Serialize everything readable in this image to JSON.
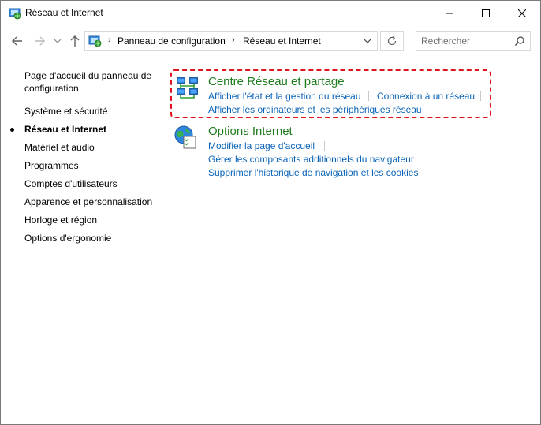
{
  "window": {
    "title": "Réseau et Internet",
    "minimize_glyph": "—",
    "maximize_glyph": "☐",
    "close_glyph": "✕"
  },
  "address": {
    "separator": "›",
    "crumbs": [
      "Panneau de configuration",
      "Réseau et Internet"
    ]
  },
  "search": {
    "placeholder": "Rechercher"
  },
  "leftnav": {
    "home": "Page d'accueil du panneau de configuration",
    "items": [
      {
        "label": "Système et sécurité",
        "active": false
      },
      {
        "label": "Réseau et Internet",
        "active": true
      },
      {
        "label": "Matériel et audio",
        "active": false
      },
      {
        "label": "Programmes",
        "active": false
      },
      {
        "label": "Comptes d'utilisateurs",
        "active": false
      },
      {
        "label": "Apparence et personnalisation",
        "active": false
      },
      {
        "label": "Horloge et région",
        "active": false
      },
      {
        "label": "Options d'ergonomie",
        "active": false
      }
    ]
  },
  "categories": [
    {
      "title": "Centre Réseau et partage",
      "links": [
        "Afficher l'état et la gestion du réseau",
        "Connexion à un réseau",
        "Afficher les ordinateurs et les périphériques réseau"
      ]
    },
    {
      "title": "Options Internet",
      "links": [
        "Modifier la page d'accueil",
        "Gérer les composants additionnels du navigateur",
        "Supprimer l'historique de navigation et les cookies"
      ]
    }
  ],
  "colors": {
    "category_title": "#1e7b1e",
    "link": "#0a63b8",
    "highlight": "#e0141e"
  }
}
